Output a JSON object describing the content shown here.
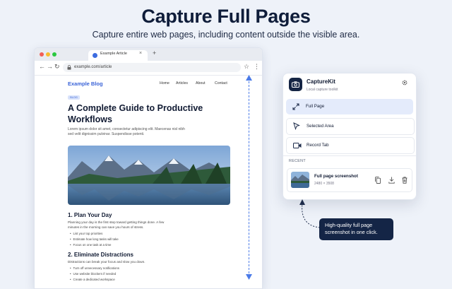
{
  "hero": {
    "title": "Capture Full Pages",
    "subtitle": "Capture entire web pages, including content outside the visible area."
  },
  "browser": {
    "tab_title": "Example Article",
    "tab_close": "×",
    "new_tab": "+",
    "url": "example.com/article",
    "nav": {
      "back": "←",
      "forward": "→",
      "reload": "↻",
      "bookmark": "☆",
      "menu": "⋮",
      "lock": "🔒"
    }
  },
  "article": {
    "blog_name": "Example Blog",
    "nav_links": [
      "Home",
      "Articles",
      "About",
      "Contact"
    ],
    "badge": "BLOG",
    "title": "A Complete Guide to Productive Workflows",
    "lede": "Lorem ipsum dolor sit amet, consectetur adipiscing elit. Maecenas nisl nibh sed velit dignissim pulvinar. Suspendisse potenti.",
    "section1": {
      "heading": "1. Plan Your Day",
      "para": "Planning your day is the first step toward getting things done. A few minutes in the morning can save you hours of stress.",
      "bullets": [
        "List your top priorities",
        "Estimate how long tasks will take",
        "Focus on one task at a time"
      ]
    },
    "section2": {
      "heading": "2. Eliminate Distractions",
      "para": "Distractions can break your focus and slow you down.",
      "bullets": [
        "Turn off unnecessary notifications",
        "Use website blockers if needed",
        "Create a dedicated workspace"
      ]
    }
  },
  "popup": {
    "app_name": "CaptureKit",
    "app_tagline": "Local capture toolkit",
    "options": [
      {
        "label": "Full Page",
        "icon": "expand-icon",
        "selected": true
      },
      {
        "label": "Selected Area",
        "icon": "cursor-icon",
        "selected": false
      },
      {
        "label": "Record Tab",
        "icon": "video-icon",
        "selected": false
      }
    ],
    "recent_label": "RECENT",
    "recent": {
      "title": "Full page screenshot",
      "dimensions": "2480 × 3508"
    }
  },
  "tooltip": {
    "text": "High-quality full page screenshot in one click."
  },
  "colors": {
    "accent": "#3b64d8",
    "dark": "#142546",
    "bg": "#eef2f9"
  }
}
